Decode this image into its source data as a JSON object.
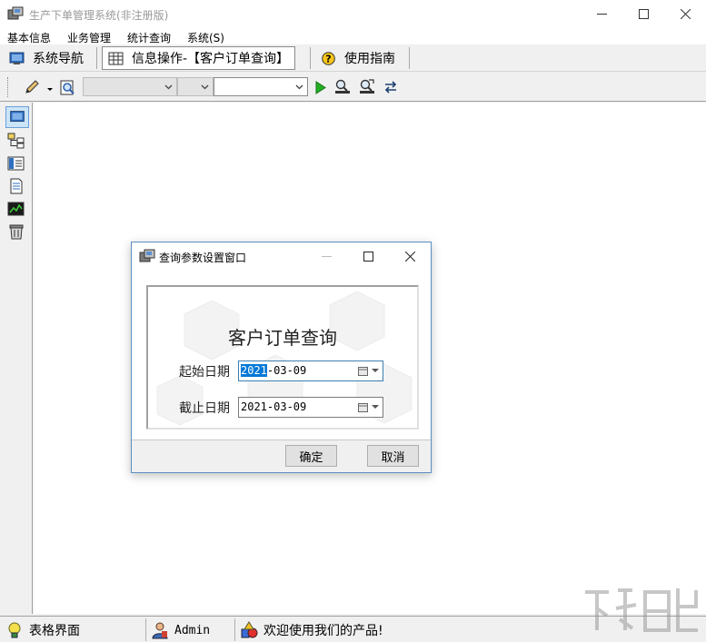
{
  "window": {
    "title": "生产下单管理系统(非注册版)"
  },
  "menu": [
    "基本信息",
    "业务管理",
    "统计查询",
    "系统(S)"
  ],
  "tabs": [
    {
      "label": "系统导航",
      "icon": "monitor-icon"
    },
    {
      "label": "信息操作-【客户订单查询】",
      "icon": "grid-icon"
    },
    {
      "label": "使用指南",
      "icon": "help-icon"
    }
  ],
  "toolbar": {
    "combo1_value": "",
    "combo2_value": "",
    "combo3_value": ""
  },
  "statusbar": {
    "view": "表格界面",
    "user": "Admin",
    "message": "欢迎使用我们的产品!"
  },
  "dialog": {
    "title": "查询参数设置窗口",
    "heading": "客户订单查询",
    "start_label": "起始日期",
    "start_year": "2021",
    "start_rest": "-03-09",
    "end_label": "截止日期",
    "end_value": "2021-03-09",
    "ok_label": "确定",
    "cancel_label": "取消"
  },
  "colors": {
    "accent": "#0078d7",
    "dialog_border": "#5b8fc4"
  }
}
